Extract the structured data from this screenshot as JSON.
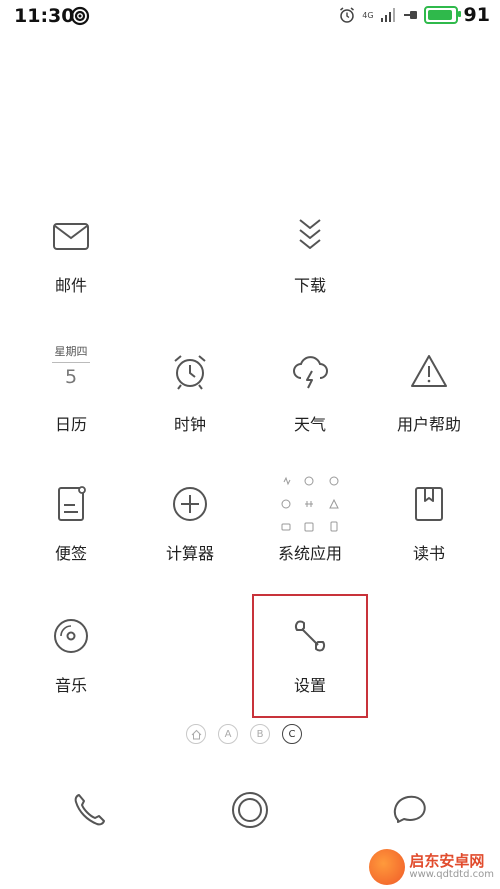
{
  "status_bar": {
    "time": "11:30",
    "network": "4G",
    "battery_level": "91",
    "battery_fraction": 0.91
  },
  "apps": {
    "mail": "邮件",
    "download": "下载",
    "calendar": "日历",
    "calendar_weekday": "星期四",
    "calendar_day": "5",
    "clock": "时钟",
    "weather": "天气",
    "help": "用户帮助",
    "notes": "便签",
    "calculator": "计算器",
    "system_apps": "系统应用",
    "reader": "读书",
    "music": "音乐",
    "settings": "设置"
  },
  "page_indicators": [
    "A",
    "B",
    "C"
  ],
  "watermark": {
    "title": "启东安卓网",
    "url": "www.qdtdtd.com"
  }
}
